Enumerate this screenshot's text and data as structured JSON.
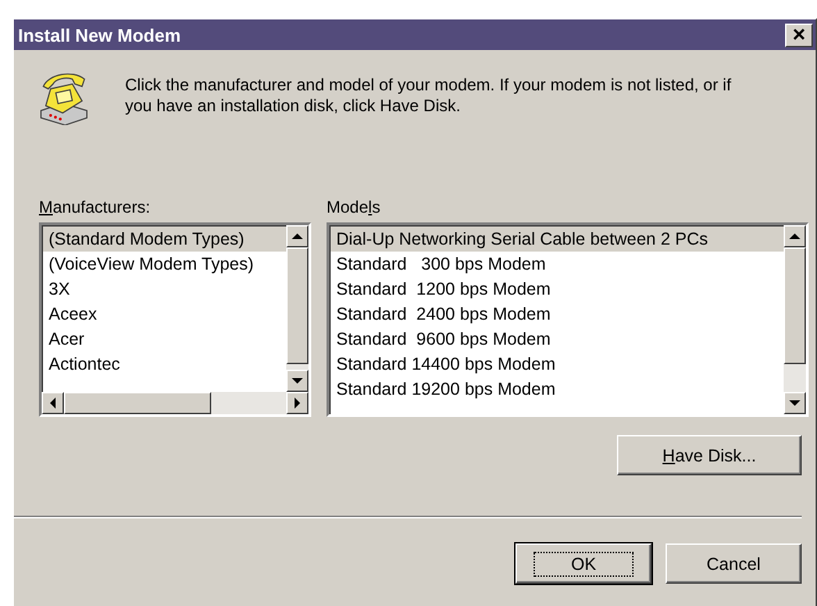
{
  "window": {
    "title": "Install New Modem",
    "close_button": "×"
  },
  "instructions": "Click the manufacturer and model of your modem. If your modem is not listed, or if you have an installation disk, click Have Disk.",
  "manufacturers": {
    "label_parts": [
      {
        "text": "M",
        "underlined": true
      },
      {
        "text": "anufacturers:",
        "underlined": false
      }
    ],
    "items": [
      {
        "text": "(Standard Modem Types)",
        "selected": true
      },
      {
        "text": "(VoiceView Modem Types)",
        "selected": false
      },
      {
        "text": "3X",
        "selected": false
      },
      {
        "text": "Aceex",
        "selected": false
      },
      {
        "text": "Acer",
        "selected": false
      },
      {
        "text": "Actiontec",
        "selected": false
      }
    ]
  },
  "models": {
    "label_parts": [
      {
        "text": "Mode",
        "underlined": false
      },
      {
        "text": "l",
        "underlined": true
      },
      {
        "text": "s",
        "underlined": false
      }
    ],
    "items": [
      {
        "text": "Dial-Up Networking Serial Cable between 2 PCs",
        "selected": true
      },
      {
        "text": "Standard   300 bps Modem",
        "selected": false
      },
      {
        "text": "Standard  1200 bps Modem",
        "selected": false
      },
      {
        "text": "Standard  2400 bps Modem",
        "selected": false
      },
      {
        "text": "Standard  9600 bps Modem",
        "selected": false
      },
      {
        "text": "Standard 14400 bps Modem",
        "selected": false
      },
      {
        "text": "Standard 19200 bps Modem",
        "selected": false
      }
    ]
  },
  "have_disk": {
    "label_parts": [
      {
        "text": "H",
        "underlined": true
      },
      {
        "text": "ave Disk...",
        "underlined": false
      }
    ]
  },
  "buttons": [
    {
      "label": "OK",
      "default": true
    },
    {
      "label": "Cancel",
      "default": false
    }
  ]
}
